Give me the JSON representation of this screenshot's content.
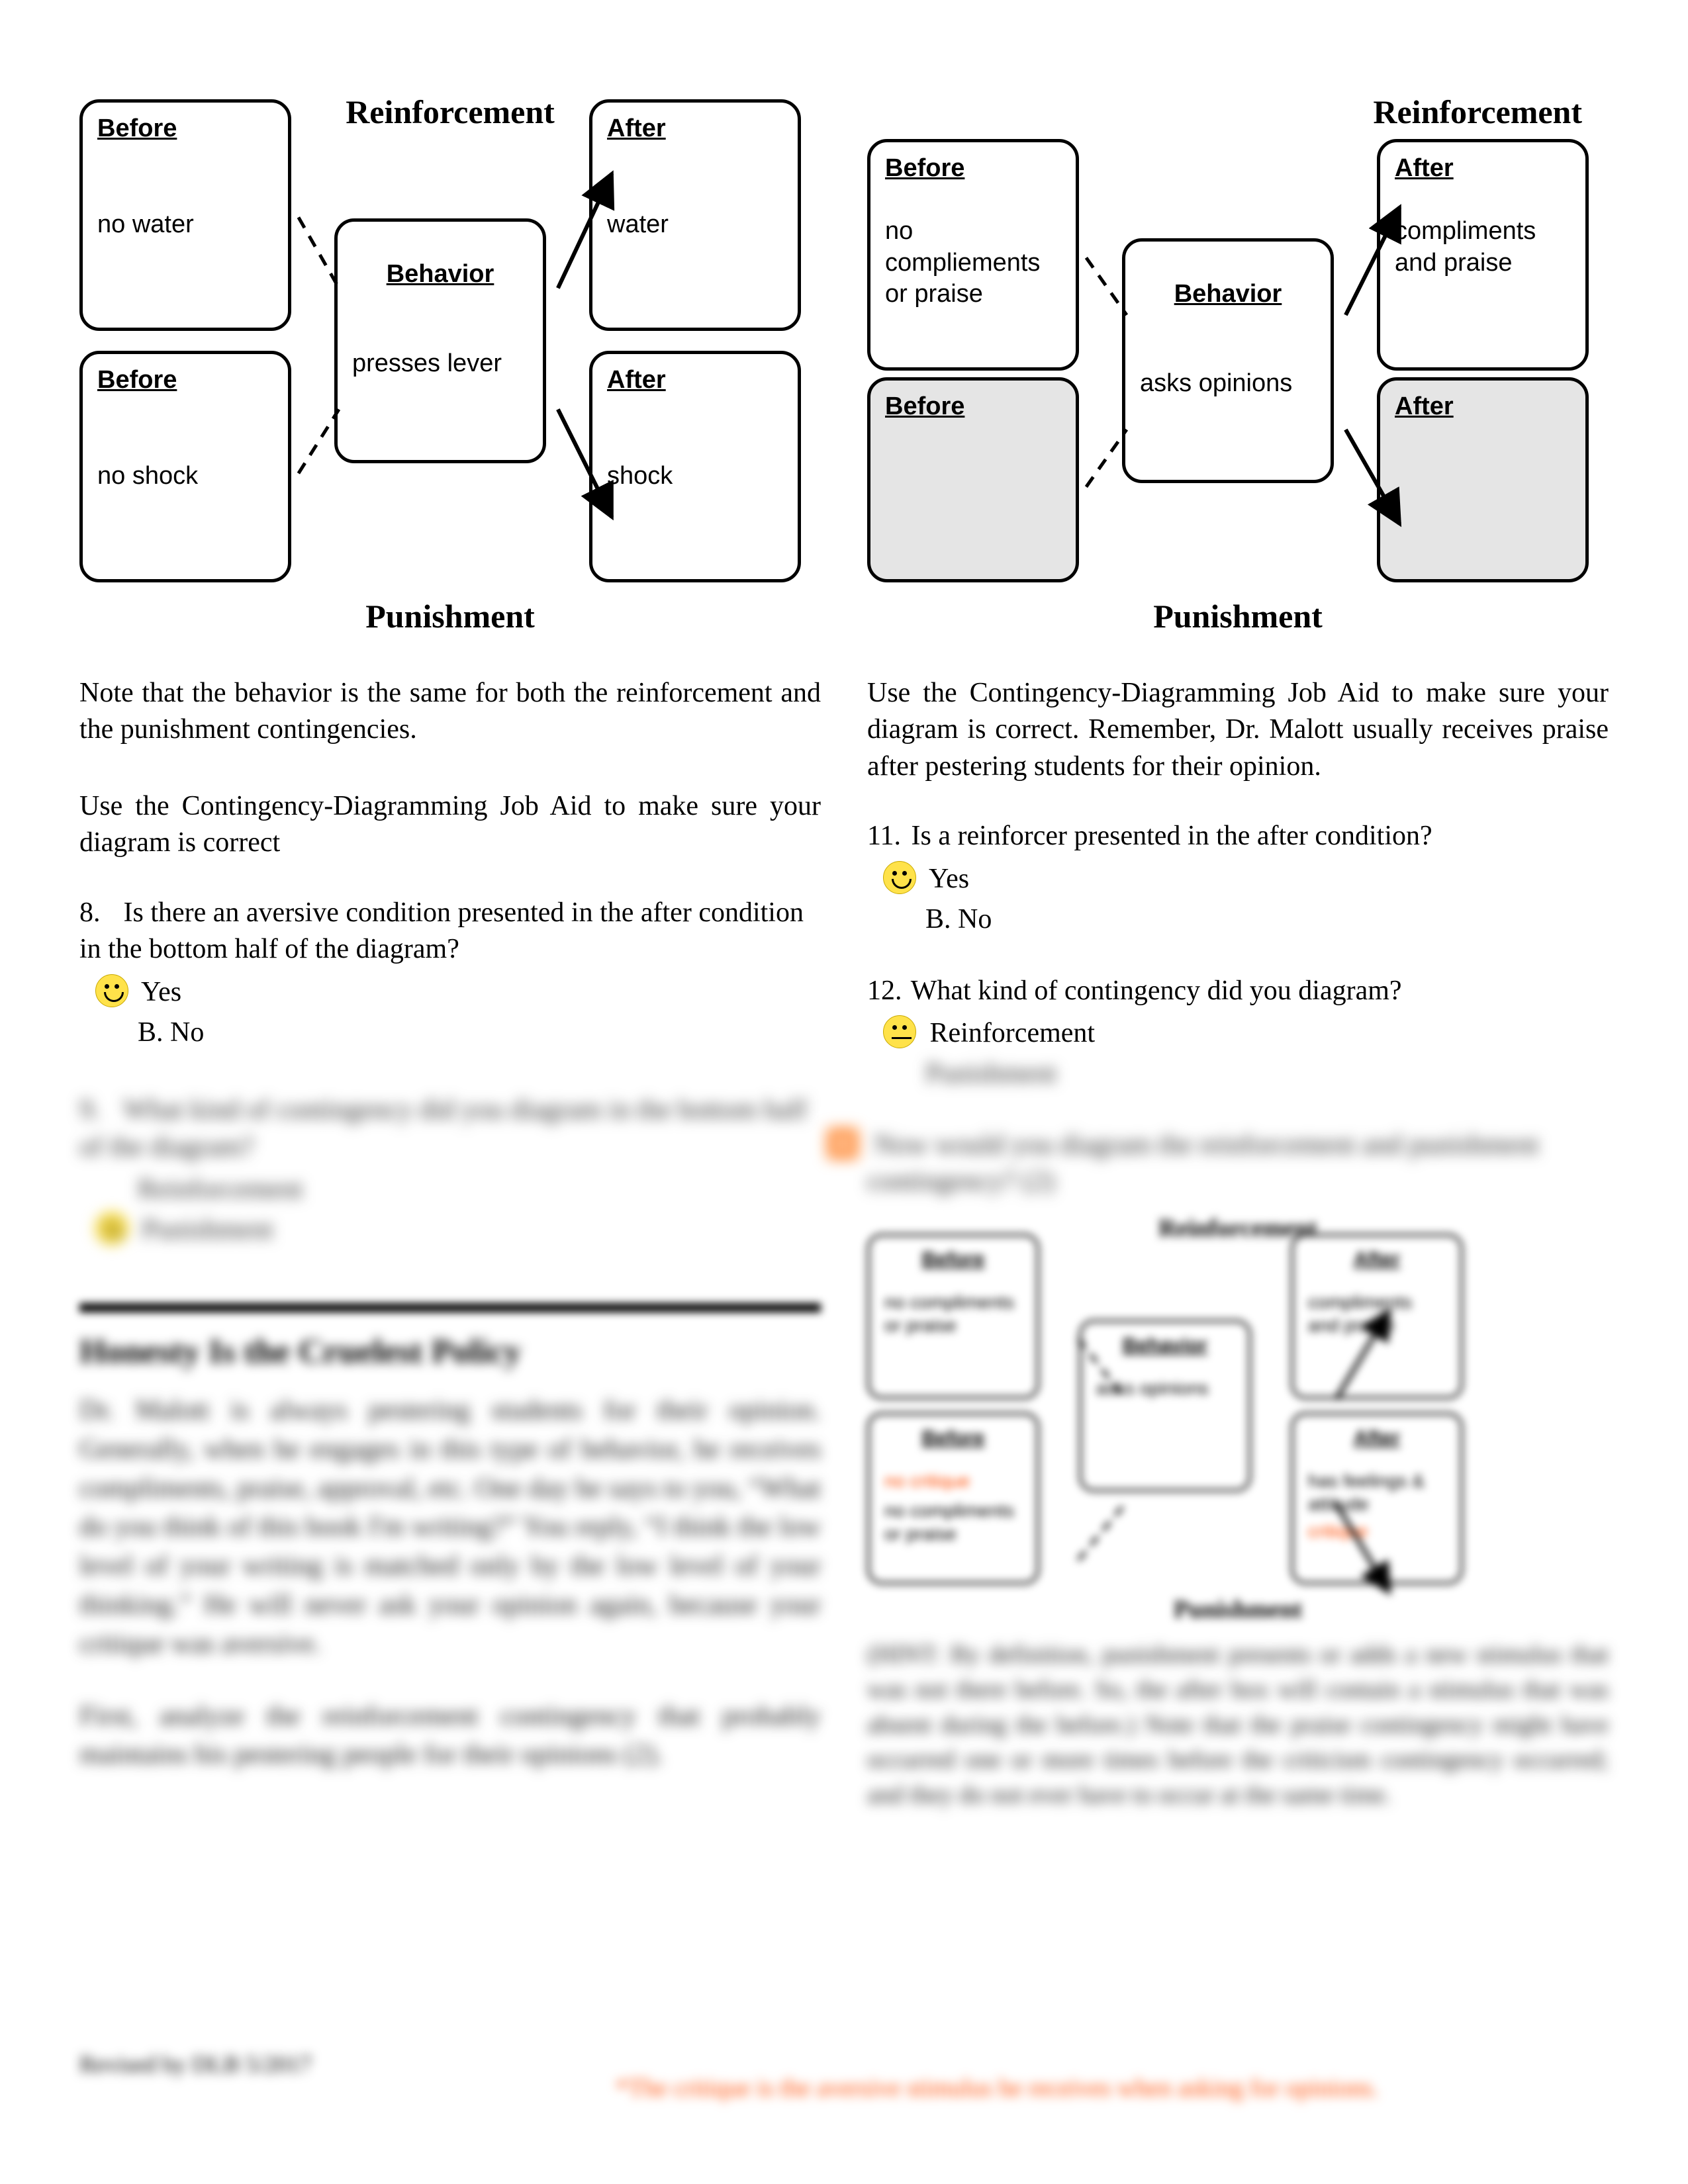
{
  "diagrams": {
    "left": {
      "reinforcement": "Reinforcement",
      "punishment": "Punishment",
      "before_top": {
        "label": "Before",
        "text": "no water"
      },
      "before_bottom": {
        "label": "Before",
        "text": "no shock"
      },
      "behavior": {
        "label": "Behavior",
        "text": "presses lever"
      },
      "after_top": {
        "label": "After",
        "text": "water"
      },
      "after_bottom": {
        "label": "After",
        "text": "shock"
      }
    },
    "right": {
      "reinforcement": "Reinforcement",
      "punishment": "Punishment",
      "before_top": {
        "label": "Before",
        "text": "no compliements or praise"
      },
      "before_bottom": {
        "label": "Before",
        "text": ""
      },
      "behavior": {
        "label": "Behavior",
        "text": "asks opinions"
      },
      "after_top": {
        "label": "After",
        "text": "compliments and praise"
      },
      "after_bottom": {
        "label": "After",
        "text": ""
      }
    }
  },
  "left_col": {
    "note": "Note that the behavior is the same for both the reinforcement and the punishment contingencies.",
    "instruction": "Use the Contingency-Diagramming Job Aid to make sure your diagram is correct",
    "q8": {
      "num": "8.",
      "stem": "Is there an aversive condition presented in the after condition in the bottom half of the diagram?",
      "optA": "Yes",
      "optB": "B.  No"
    },
    "q9_blur": {
      "stem": "What kind of contingency did you diagram in the bottom half of the diagram?",
      "optA": "Reinforcement",
      "optB": "Punishment"
    },
    "section_heading": "Honesty Is the Cruelest Policy",
    "story": "Dr. Malott is always pestering students for their opinion. Generally, when he engages in this type of behavior, he receives compliments, praise, approval, etc. One day he says to you, “What do you think of this book I'm writing?” You reply, “I think the low level of your writing is matched only by the low level of your thinking.” He will never ask your opinion again, because your critique was aversive.",
    "q10": "First, analyze the reinforcement contingency that probably maintains his pestering people for their opinions (2)."
  },
  "right_col": {
    "instruction": "Use the Contingency-Diagramming Job Aid to make sure your diagram is correct.  Remember, Dr. Malott usually receives praise after pestering students for their opinion.",
    "q11": {
      "num": "11.",
      "stem": "Is a reinforcer presented in the after condition?",
      "optA": "Yes",
      "optB": "B.  No"
    },
    "q12": {
      "num": "12.",
      "stem": "What kind of contingency did you diagram?",
      "optA": "Reinforcement",
      "optB": "Punishment"
    },
    "prompt_blur": "Now would you diagram the reinforcement and punishment contingency? (2)",
    "mini": {
      "reinforcement": "Reinforcement",
      "punishment": "Punishment",
      "before_top_label": "Before",
      "before_top_text": "no compliments or praise",
      "before_bottom_label": "Before",
      "before_bottom_text_red": "no critique",
      "before_bottom_text": "no compliments or praise",
      "behavior_label": "Behavior",
      "behavior_text": "asks opinions",
      "after_top_label": "After",
      "after_top_text": "compliments and praise",
      "after_bottom_label": "After",
      "after_bottom_text": "has feelings & attitude",
      "after_bottom_red": "critique"
    },
    "hint": "(HINT: By definition, punishment presents or adds a new stimulus that was not there before. So, the after box will contain a stimulus that was absent during the before.) Note that the praise contingency might have occurred one or more times before the criticism contingency occurred; and they do not ever have to occur at the same time."
  },
  "footer": {
    "left": "Revised by DLB 5/2017",
    "note": "*The critique is the aversive stimulus he receives when asking for opinions."
  }
}
